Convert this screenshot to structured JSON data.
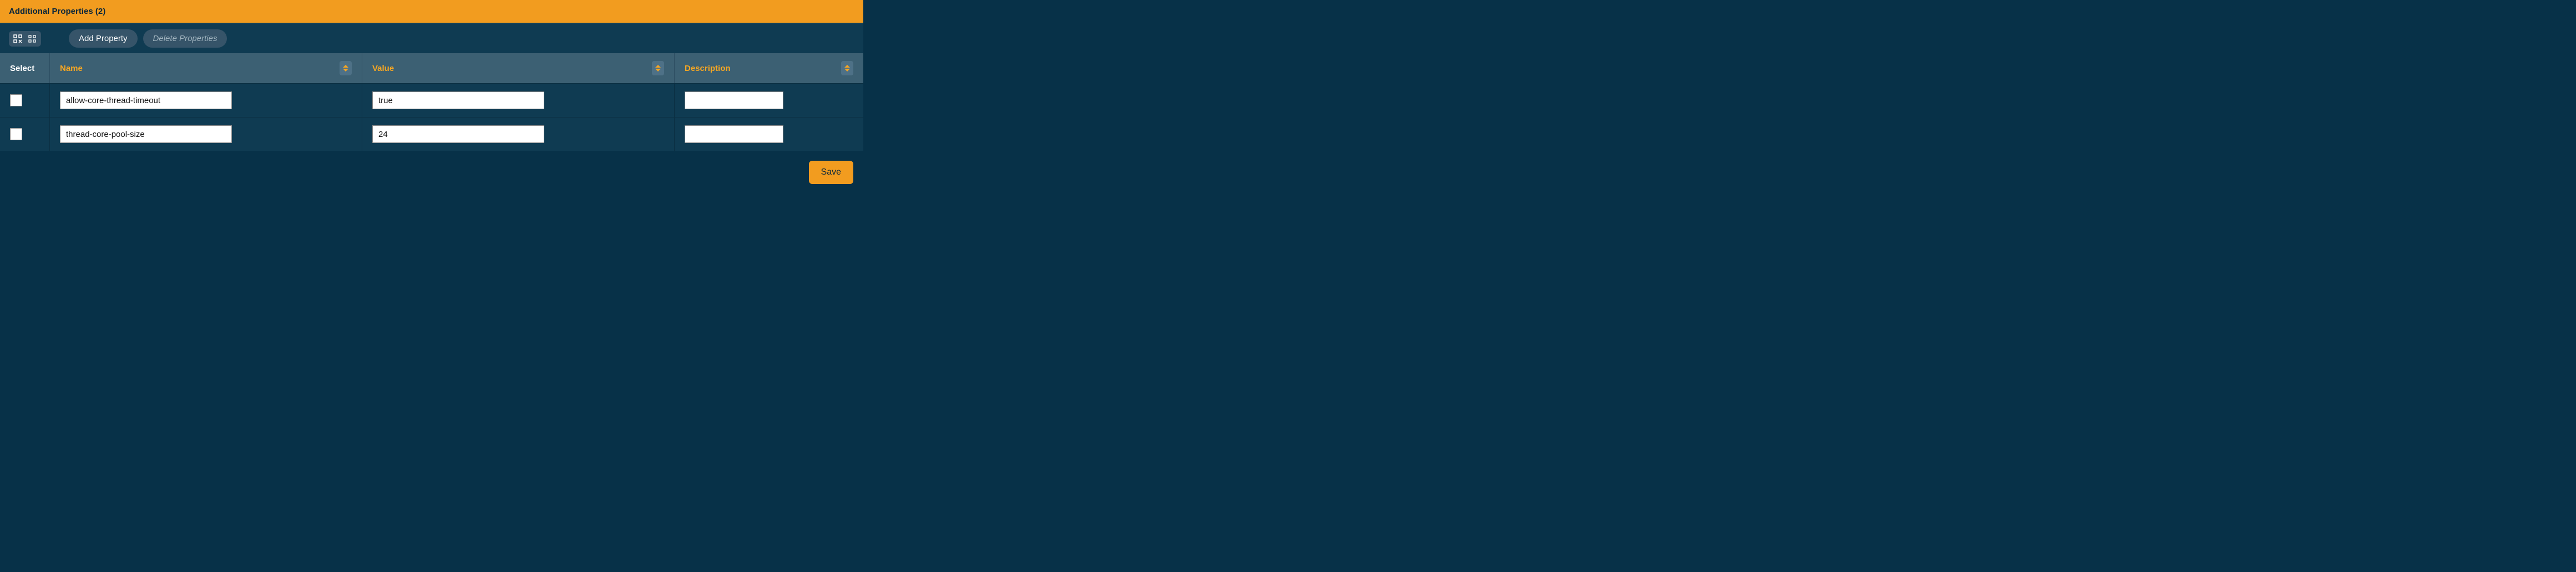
{
  "header": {
    "title": "Additional Properties (2)"
  },
  "toolbar": {
    "add_label": "Add Property",
    "delete_label": "Delete Properties"
  },
  "columns": {
    "select": "Select",
    "name": "Name",
    "value": "Value",
    "description": "Description"
  },
  "rows": [
    {
      "name": "allow-core-thread-timeout",
      "value": "true",
      "description": ""
    },
    {
      "name": "thread-core-pool-size",
      "value": "24",
      "description": ""
    }
  ],
  "footer": {
    "save_label": "Save"
  }
}
